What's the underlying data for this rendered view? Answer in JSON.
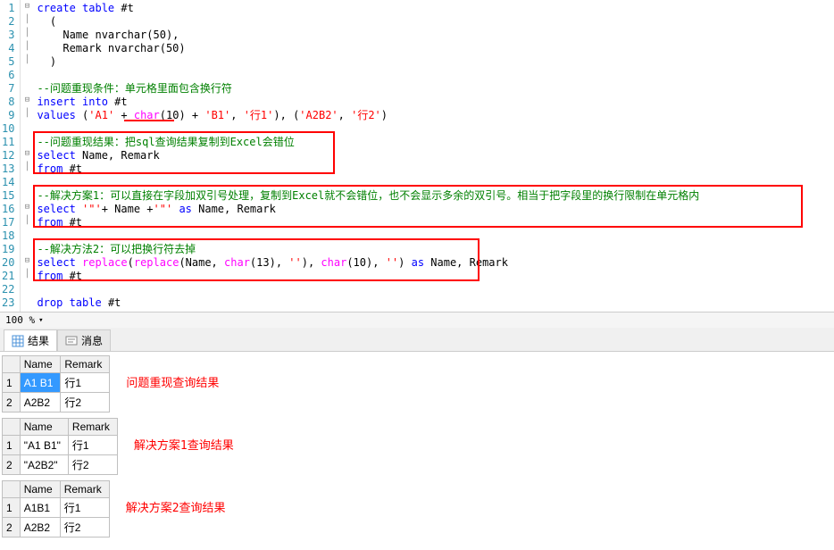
{
  "zoom": "100 %",
  "tabs": {
    "results": "结果",
    "messages": "消息"
  },
  "labels": {
    "r1": "问题重现查询结果",
    "r2": "解决方案1查询结果",
    "r3": "解决方案2查询结果"
  },
  "cols": {
    "c1": "Name",
    "c2": "Remark"
  },
  "res1": {
    "r1c1": "A1 B1",
    "r1c2": "行1",
    "r2c1": "A2B2",
    "r2c2": "行2"
  },
  "res2": {
    "r1c1": "\"A1 B1\"",
    "r1c2": "行1",
    "r2c1": "\"A2B2\"",
    "r2c2": "行2"
  },
  "res3": {
    "r1c1": "A1B1",
    "r1c2": "行1",
    "r2c1": "A2B2",
    "r2c2": "行2"
  },
  "ln": {
    "1": "1",
    "2": "2",
    "3": "3",
    "4": "4",
    "5": "5",
    "6": "6",
    "7": "7",
    "8": "8",
    "9": "9",
    "10": "10",
    "11": "11",
    "12": "12",
    "13": "13",
    "14": "14",
    "15": "15",
    "16": "16",
    "17": "17",
    "18": "18",
    "19": "19",
    "20": "20",
    "21": "21",
    "22": "22",
    "23": "23"
  },
  "code": {
    "l1a": "create",
    "l1b": " table",
    "l1c": " #t",
    "l2": "  (",
    "l3": "    Name nvarchar(50),",
    "l4": "    Remark nvarchar(50)",
    "l5": "  )",
    "l7": "--问题重现条件：单元格里面包含换行符",
    "l8a": "insert",
    "l8b": " into",
    "l8c": " #t",
    "l9a": "values",
    "l9b": " (",
    "l9c": "'A1'",
    "l9d": " + ",
    "l9e": "char",
    "l9f": "(10) + ",
    "l9g": "'B1'",
    "l9h": ", ",
    "l9i": "'行1'",
    "l9j": "), (",
    "l9k": "'A2B2'",
    "l9l": ", ",
    "l9m": "'行2'",
    "l9n": ")",
    "l11": "--问题重现结果：把sql查询结果复制到Excel会错位",
    "l12a": "select",
    "l12b": " Name, Remark",
    "l13a": "from",
    "l13b": " #t",
    "l15": "--解决方案1：可以直接在字段加双引号处理，复制到Excel就不会错位，也不会显示多余的双引号。相当于把字段里的换行限制在单元格内",
    "l16a": "select",
    "l16b": " ",
    "l16c": "'\"'",
    "l16d": "+ Name +",
    "l16e": "'\"'",
    "l16f": " as",
    "l16g": " Name, Remark",
    "l17a": "from",
    "l17b": " #t",
    "l19": "--解决方法2：可以把换行符去掉",
    "l20a": "select",
    "l20b": " ",
    "l20c": "replace",
    "l20d": "(",
    "l20e": "replace",
    "l20f": "(Name, ",
    "l20g": "char",
    "l20h": "(13), ",
    "l20i": "''",
    "l20j": "), ",
    "l20k": "char",
    "l20l": "(10), ",
    "l20m": "''",
    "l20n": ") ",
    "l20o": "as",
    "l20p": " Name, Remark",
    "l21a": "from",
    "l21b": " #t",
    "l23a": "drop",
    "l23b": " table",
    "l23c": " #t"
  }
}
